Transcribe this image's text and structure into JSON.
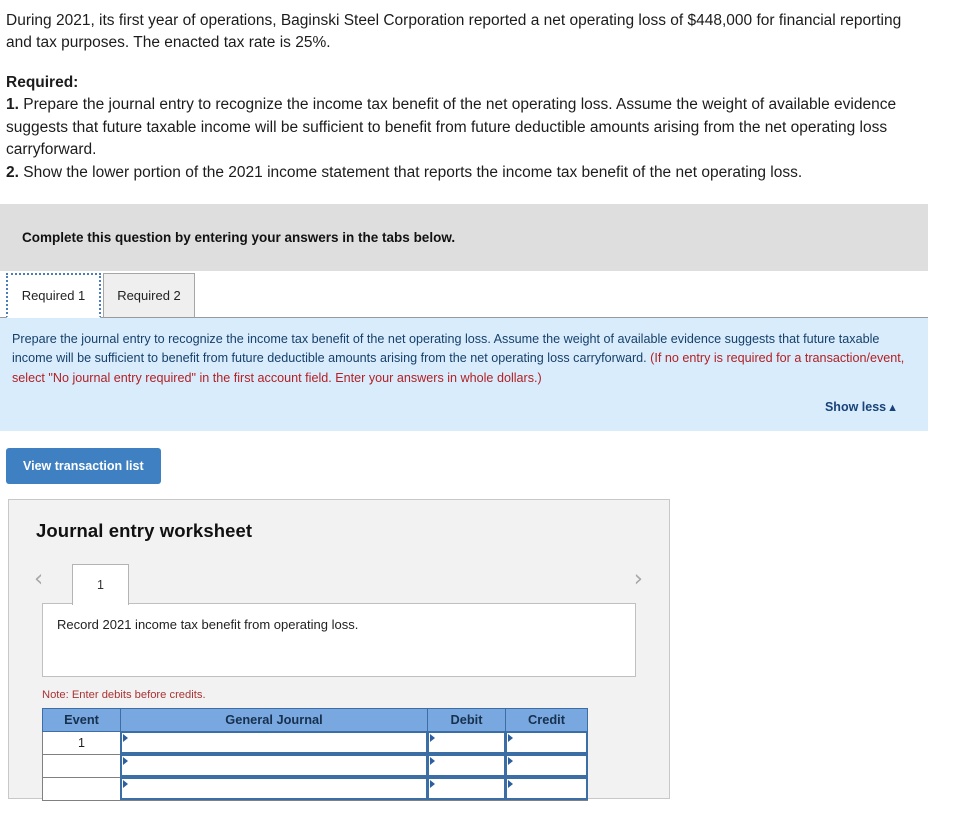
{
  "problem": {
    "paragraph1": "During 2021, its first year of operations, Baginski Steel Corporation reported a net operating loss of $448,000 for financial reporting and tax purposes. The enacted tax rate is 25%.",
    "required_heading": "Required:",
    "req1_number": "1.",
    "req1_text": " Prepare the journal entry to recognize the income tax benefit of the net operating loss. Assume the weight of available evidence suggests that future taxable income will be sufficient to benefit from future deductible amounts arising from the net operating loss carryforward.",
    "req2_number": "2.",
    "req2_text": " Show the lower portion of the 2021 income statement that reports the income tax benefit of the net operating loss."
  },
  "instruction_bar": {
    "text": "Complete this question by entering your answers in the tabs below."
  },
  "tabs": [
    {
      "label": "Required 1",
      "active": true
    },
    {
      "label": "Required 2",
      "active": false
    }
  ],
  "info_panel": {
    "main_text": "Prepare the journal entry to recognize the income tax benefit of the net operating loss. Assume the weight of available evidence suggests that future taxable income will be sufficient to benefit from future deductible amounts arising from the net operating loss carryforward. ",
    "red_text": "(If no entry is required for a transaction/event, select \"No journal entry required\" in the first account field. Enter your answers in whole dollars.)",
    "show_less_label": "Show less",
    "show_less_caret": "▲"
  },
  "toolbar": {
    "view_transaction_list_label": "View transaction list"
  },
  "worksheet": {
    "title": "Journal entry worksheet",
    "prev_arrow": "‹",
    "next_arrow": "›",
    "page_tab_label": "1",
    "description": "Record 2021 income tax benefit from operating loss.",
    "note": "Note: Enter debits before credits."
  },
  "journal_table": {
    "headers": [
      "Event",
      "General Journal",
      "Debit",
      "Credit"
    ],
    "rows": [
      {
        "event": "1",
        "general_journal": "",
        "debit": "",
        "credit": ""
      },
      {
        "event": "",
        "general_journal": "",
        "debit": "",
        "credit": ""
      },
      {
        "event": "",
        "general_journal": "",
        "debit": "",
        "credit": ""
      }
    ]
  },
  "colors": {
    "accent_blue": "#3e80c1",
    "table_header_blue": "#79a8e0",
    "info_panel_bg": "#d9ecfb",
    "instruction_bar_bg": "#dedede",
    "note_red": "#b32025"
  }
}
